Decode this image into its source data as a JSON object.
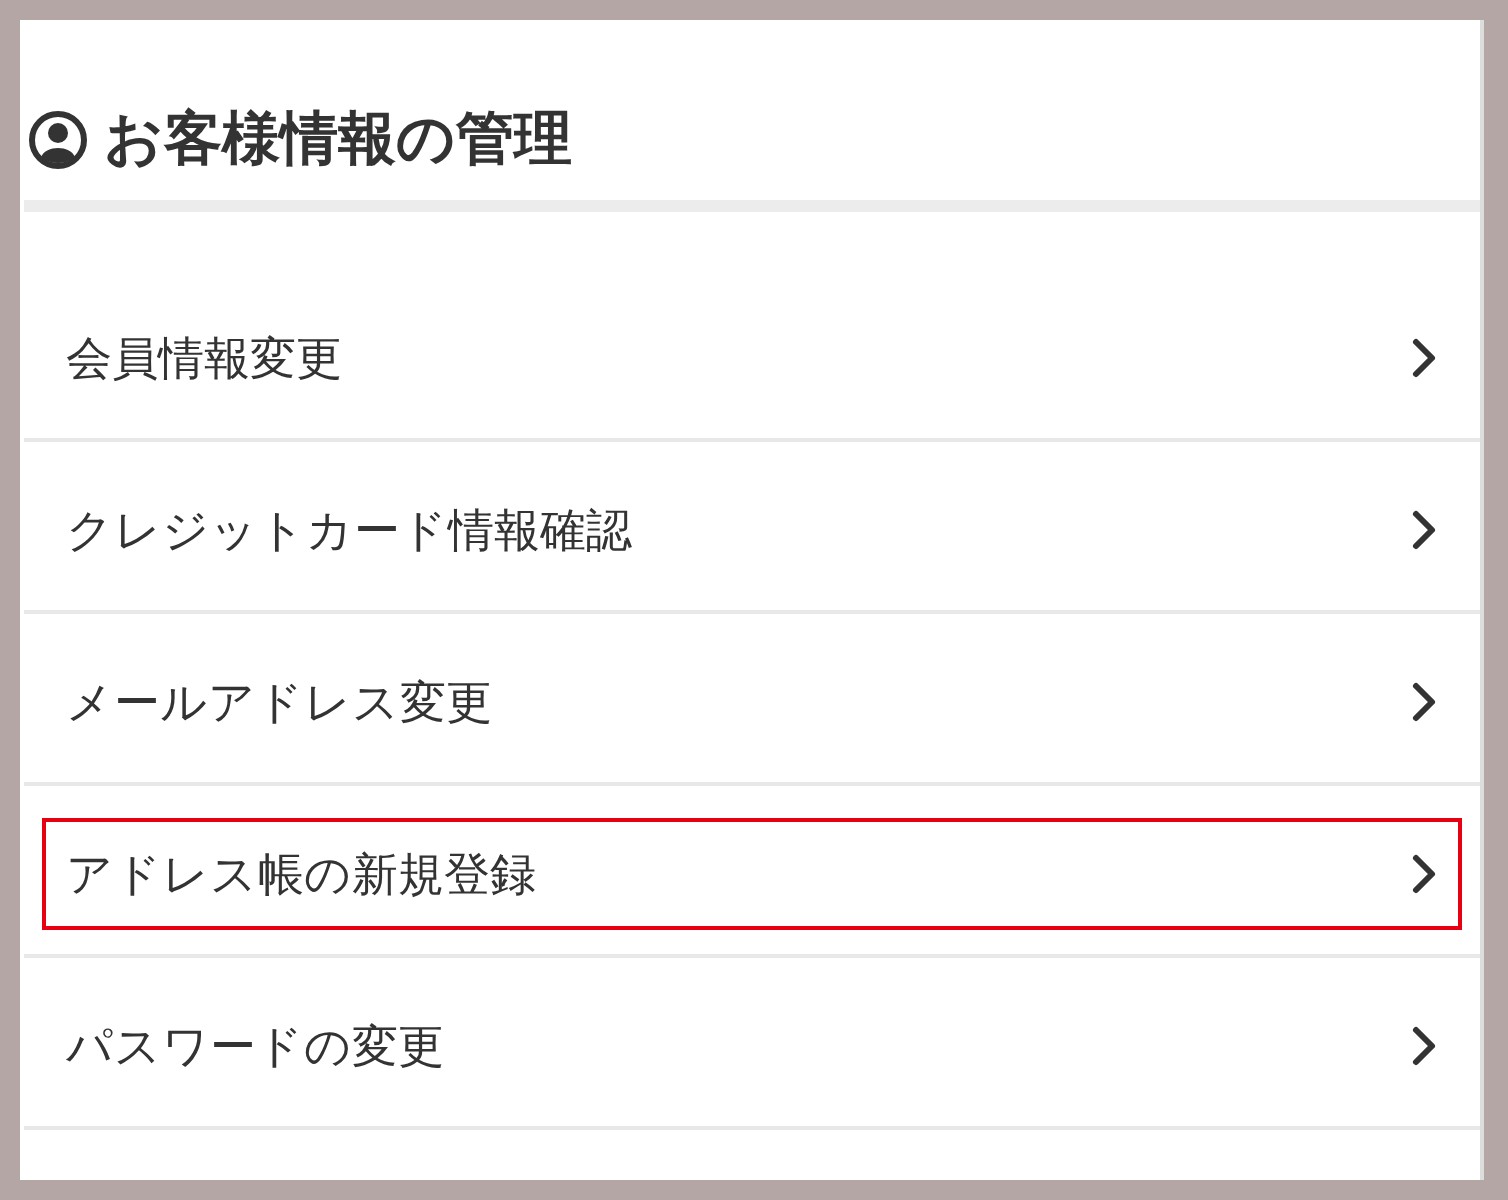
{
  "header": {
    "title": "お客様情報の管理"
  },
  "menu": [
    {
      "label": "会員情報変更",
      "highlighted": false
    },
    {
      "label": "クレジットカード情報確認",
      "highlighted": false
    },
    {
      "label": "メールアドレス変更",
      "highlighted": false
    },
    {
      "label": "アドレス帳の新規登録",
      "highlighted": true
    },
    {
      "label": "パスワードの変更",
      "highlighted": false
    }
  ]
}
